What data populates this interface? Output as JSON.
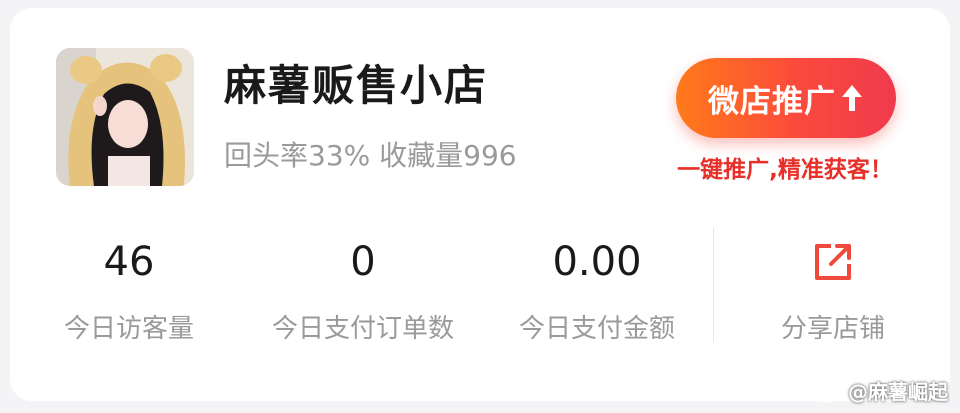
{
  "shop": {
    "name": "麻薯贩售小店",
    "stats": "回头率33% 收藏量996"
  },
  "promo": {
    "button_label": "微店推广",
    "subtitle": "一键推广,精准获客！",
    "icon": "up-arrow-icon"
  },
  "metrics": [
    {
      "value": "46",
      "label": "今日访客量"
    },
    {
      "value": "0",
      "label": "今日支付订单数"
    },
    {
      "value": "0.00",
      "label": "今日支付金额"
    }
  ],
  "share": {
    "label": "分享店铺",
    "icon": "share-external-icon"
  },
  "watermark": {
    "text": "@麻薯崛起",
    "icon": "weibo-icon"
  },
  "colors": {
    "accent": "#f04a3c",
    "accent_start": "#ff7a1a",
    "muted": "#9a9a9a",
    "text": "#1a1a1a"
  }
}
